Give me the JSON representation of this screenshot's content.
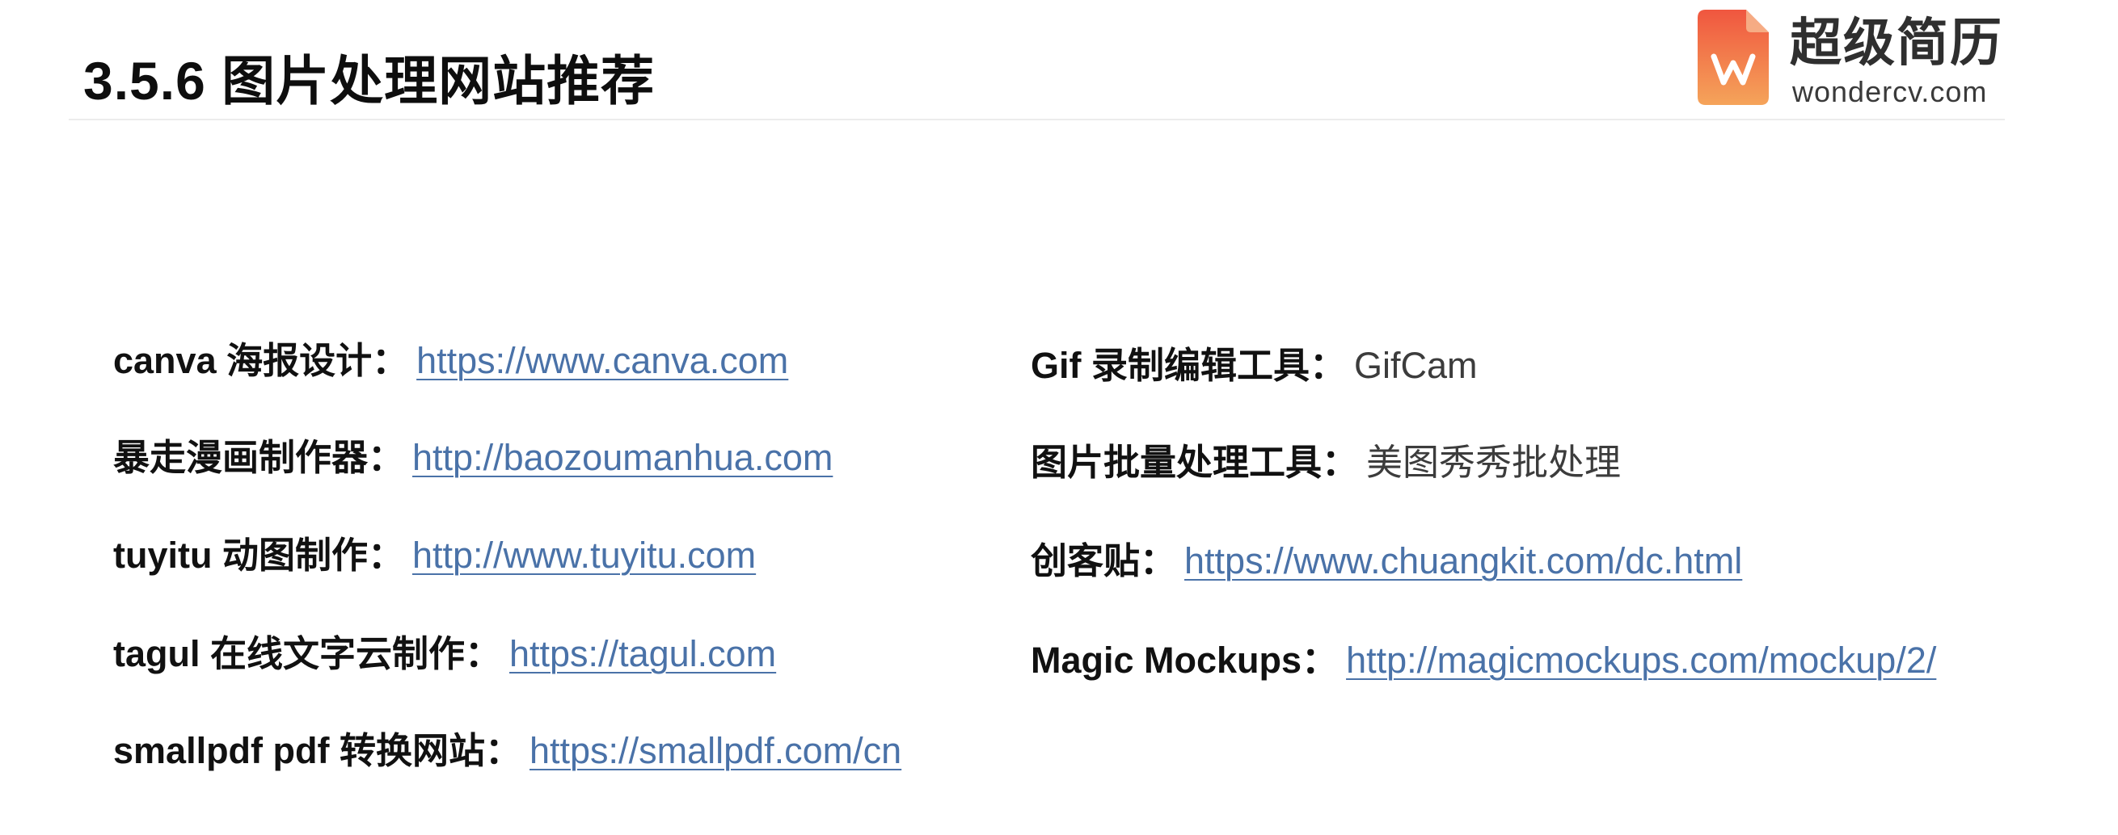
{
  "slide": {
    "title": "3.5.6 图片处理网站推荐"
  },
  "logo": {
    "name_cn": "超级简历",
    "domain": "wondercv.com",
    "colors": {
      "top": "#f0563f",
      "bottom": "#f5a45a"
    }
  },
  "left_column": [
    {
      "label": "canva 海报设计：",
      "value": "https://www.canva.com",
      "is_link": true
    },
    {
      "label": "暴走漫画制作器：",
      "value": "http://baozoumanhua.com",
      "is_link": true
    },
    {
      "label": "tuyitu 动图制作：",
      "value": "http://www.tuyitu.com",
      "is_link": true
    },
    {
      "label": "tagul 在线文字云制作：",
      "value": "https://tagul.com",
      "is_link": true
    },
    {
      "label": "smallpdf pdf 转换网站：",
      "value": "https://smallpdf.com/cn",
      "is_link": true
    }
  ],
  "right_column": [
    {
      "label": "Gif 录制编辑工具：",
      "value": "GifCam",
      "is_link": false
    },
    {
      "label": "图片批量处理工具：",
      "value": "美图秀秀批处理",
      "is_link": false
    },
    {
      "label": "创客贴：",
      "value": "https://www.chuangkit.com/dc.html",
      "is_link": true
    },
    {
      "label": "Magic Mockups：",
      "value": "http://magicmockups.com/mockup/2/",
      "is_link": true
    }
  ],
  "colors": {
    "link": "#4a72a8",
    "label": "#111111",
    "plain_value": "#3c3c3c"
  }
}
